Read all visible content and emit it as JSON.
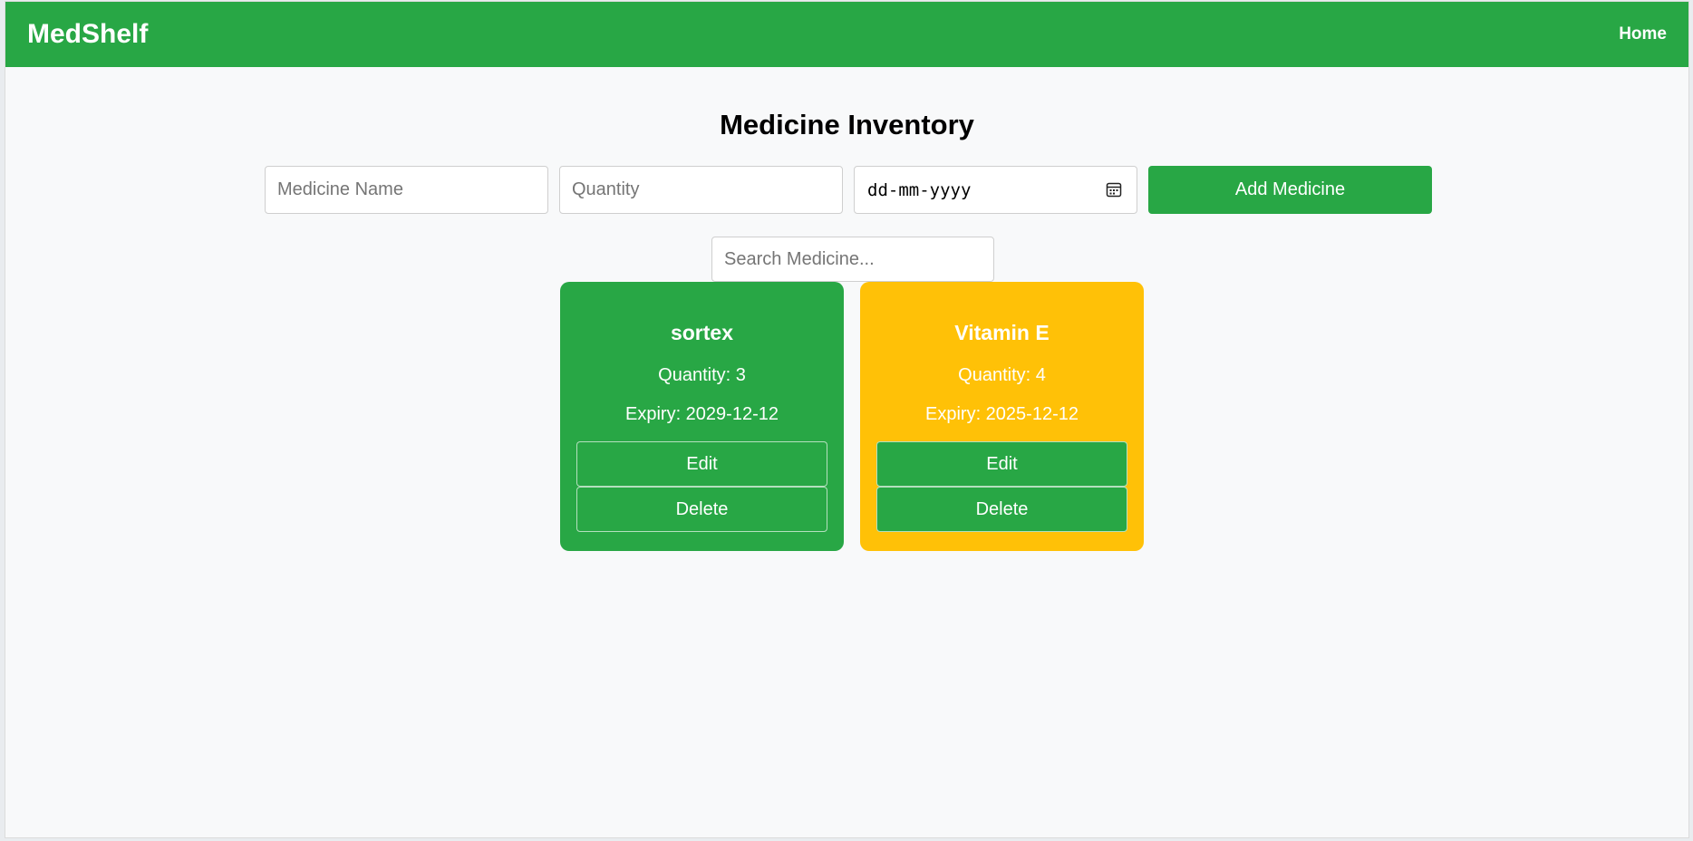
{
  "navbar": {
    "brand": "MedShelf",
    "home_link": "Home"
  },
  "page": {
    "title": "Medicine Inventory"
  },
  "form": {
    "name_placeholder": "Medicine Name",
    "quantity_placeholder": "Quantity",
    "date_placeholder": "dd-mm-yyyy",
    "add_button": "Add Medicine"
  },
  "search": {
    "placeholder": "Search Medicine..."
  },
  "medicines": [
    {
      "name": "sortex",
      "quantity": "Quantity: 3",
      "expiry": "Expiry: 2029-12-12",
      "card_color": "#28a745",
      "edit_label": "Edit",
      "delete_label": "Delete"
    },
    {
      "name": "Vitamin E",
      "quantity": "Quantity: 4",
      "expiry": "Expiry: 2025-12-12",
      "card_color": "#ffc107",
      "edit_label": "Edit",
      "delete_label": "Delete"
    }
  ],
  "colors": {
    "primary_green": "#28a745",
    "warning_yellow": "#ffc107",
    "background": "#f8f9fa"
  },
  "icons": {
    "date_picker": "calendar-icon"
  }
}
